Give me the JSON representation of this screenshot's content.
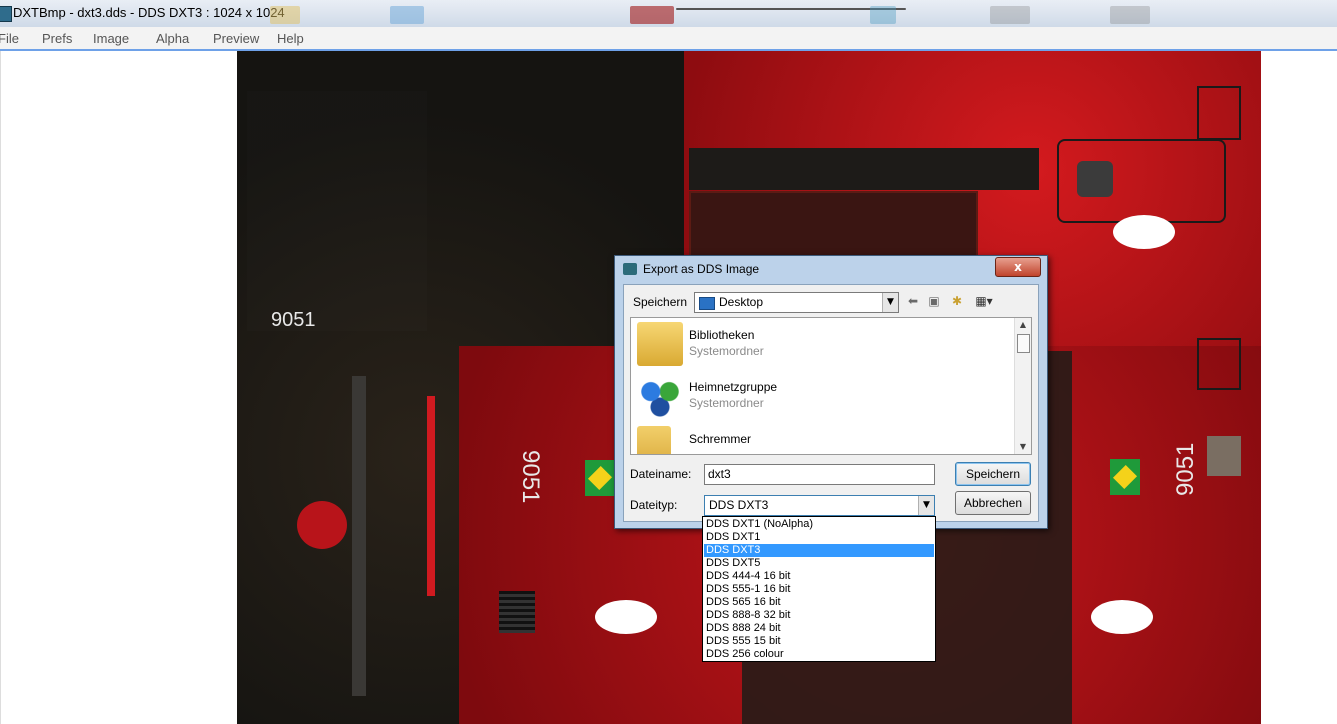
{
  "window": {
    "title": "DXTBmp - dxt3.dds - DDS DXT3 : 1024 x 1024"
  },
  "menu": [
    "File",
    "Prefs",
    "Image",
    "Alpha",
    "Preview",
    "Help"
  ],
  "texture": {
    "numbers": [
      "9051",
      "9051",
      "9051"
    ]
  },
  "dialog": {
    "title": "Export as DDS Image",
    "close_label": "x",
    "save_in_label": "Speichern",
    "save_in_value": "Desktop",
    "items": [
      {
        "name": "Bibliotheken",
        "sub": "Systemordner",
        "icon": "libraries-folder-icon"
      },
      {
        "name": "Heimnetzgruppe",
        "sub": "Systemordner",
        "icon": "homegroup-icon"
      },
      {
        "name": "Schremmer",
        "sub": "",
        "icon": "user-folder-icon"
      }
    ],
    "filename_label": "Dateiname:",
    "filename_value": "dxt3",
    "filetype_label": "Dateityp:",
    "filetype_value": "DDS DXT3",
    "save_button": "Speichern",
    "cancel_button": "Abbrechen",
    "filetype_options": [
      "DDS DXT1 (NoAlpha)",
      "DDS DXT1",
      "DDS DXT3",
      "DDS DXT5",
      "DDS 444-4 16 bit",
      "DDS 555-1 16 bit",
      "DDS 565 16 bit",
      "DDS 888-8 32 bit",
      "DDS 888 24 bit",
      "DDS 555 15 bit",
      "DDS 256 colour"
    ],
    "selected_option_index": 2
  },
  "colors": {
    "accent": "#3399ff",
    "texture_red": "#c0141a",
    "texture_dark": "#1c1a17"
  }
}
